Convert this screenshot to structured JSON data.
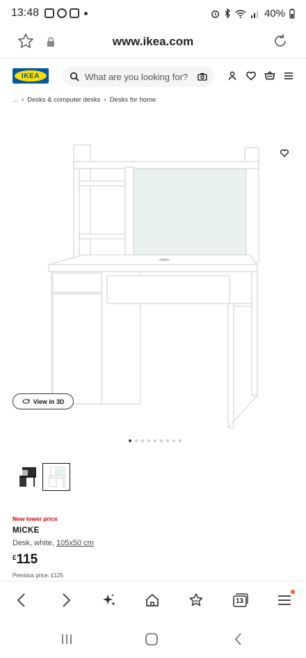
{
  "status_bar": {
    "time": "13:48",
    "battery": "40%"
  },
  "browser": {
    "url": "www.ikea.com",
    "tabs_count": "13"
  },
  "header": {
    "logo_text": "IKEA",
    "search_placeholder": "What are you looking for?"
  },
  "breadcrumb": {
    "ellipsis": "...",
    "items": [
      "Desks & computer desks",
      "Desks for home"
    ]
  },
  "gallery": {
    "view3d_label": "View in 3D",
    "total_images": 9,
    "active_index": 0
  },
  "product": {
    "price_label": "New lower price",
    "name": "MICKE",
    "desc_prefix": "Desk, white, ",
    "dimensions": "105x50 cm",
    "currency": "£",
    "price": "115",
    "previous_price": "Previous price: £125"
  },
  "icons": {
    "status": [
      "sim-icon",
      "alarm-icon",
      "bluetooth-icon",
      "wifi-icon",
      "signal-icon",
      "battery-icon"
    ],
    "header": [
      "account-icon",
      "heart-icon",
      "cart-icon",
      "menu-icon"
    ],
    "toolbar": [
      "back-icon",
      "forward-icon",
      "sparkle-icon",
      "home-icon",
      "bookmark-star-icon",
      "tabs-icon",
      "menu-icon"
    ]
  },
  "colors": {
    "ikea_blue": "#0058a3",
    "ikea_yellow": "#ffdb00",
    "sale_red": "#cc0008",
    "notification": "#ff5722"
  }
}
